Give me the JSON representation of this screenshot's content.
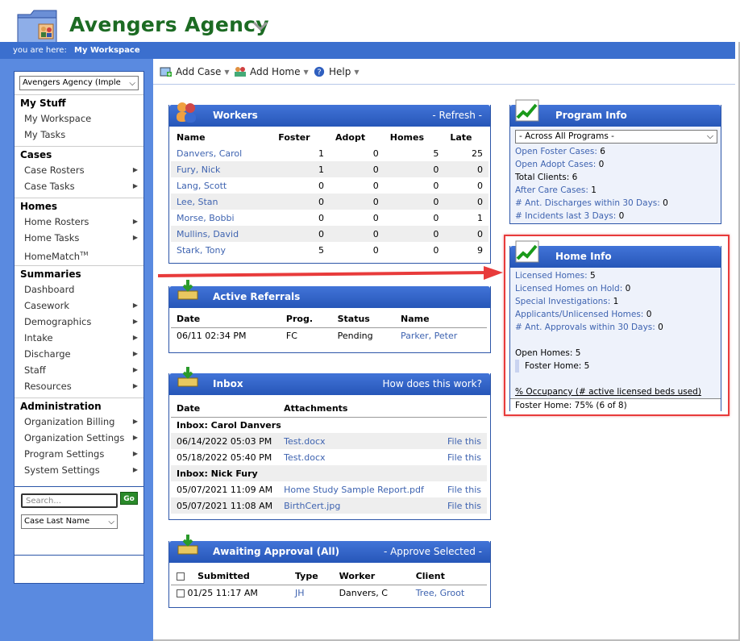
{
  "header": {
    "title": "Avengers Agency",
    "breadcrumb_label": "you are here:",
    "breadcrumb_value": "My Workspace"
  },
  "nav": {
    "agency_select": "Avengers Agency (Imple",
    "sections": [
      {
        "heading": "My Stuff",
        "items": [
          {
            "label": "My Workspace",
            "arrow": false
          },
          {
            "label": "My Tasks",
            "arrow": false
          }
        ]
      },
      {
        "heading": "Cases",
        "items": [
          {
            "label": "Case Rosters",
            "arrow": true
          },
          {
            "label": "Case Tasks",
            "arrow": true
          }
        ]
      },
      {
        "heading": "Homes",
        "items": [
          {
            "label": "Home Rosters",
            "arrow": true
          },
          {
            "label": "Home Tasks",
            "arrow": true
          },
          {
            "label": "HomeMatch",
            "sup": "TM",
            "arrow": false
          }
        ]
      },
      {
        "heading": "Summaries",
        "items": [
          {
            "label": "Dashboard",
            "arrow": false
          },
          {
            "label": "Casework",
            "arrow": true
          },
          {
            "label": "Demographics",
            "arrow": true
          },
          {
            "label": "Intake",
            "arrow": true
          },
          {
            "label": "Discharge",
            "arrow": true
          },
          {
            "label": "Staff",
            "arrow": true
          },
          {
            "label": "Resources",
            "arrow": true
          }
        ]
      },
      {
        "heading": "Administration",
        "items": [
          {
            "label": "Organization Billing",
            "arrow": true
          },
          {
            "label": "Organization Settings",
            "arrow": true
          },
          {
            "label": "Program Settings",
            "arrow": true
          },
          {
            "label": "System Settings",
            "arrow": true
          }
        ]
      }
    ],
    "search_placeholder": "Search...",
    "go_label": "Go",
    "search_type": "Case Last Name"
  },
  "toolbar": {
    "add_case": "Add Case",
    "add_home": "Add Home",
    "help": "Help"
  },
  "workers": {
    "title": "Workers",
    "refresh": "- Refresh -",
    "columns": [
      "Name",
      "Foster",
      "Adopt",
      "Homes",
      "Late"
    ],
    "rows": [
      [
        "Danvers, Carol",
        "1",
        "0",
        "5",
        "25"
      ],
      [
        "Fury, Nick",
        "1",
        "0",
        "0",
        "0"
      ],
      [
        "Lang, Scott",
        "0",
        "0",
        "0",
        "0"
      ],
      [
        "Lee, Stan",
        "0",
        "0",
        "0",
        "0"
      ],
      [
        "Morse, Bobbi",
        "0",
        "0",
        "0",
        "1"
      ],
      [
        "Mullins, David",
        "0",
        "0",
        "0",
        "0"
      ],
      [
        "Stark, Tony",
        "5",
        "0",
        "0",
        "9"
      ]
    ]
  },
  "referrals": {
    "title": "Active Referrals",
    "columns": [
      "Date",
      "Prog.",
      "Status",
      "Name"
    ],
    "rows": [
      [
        "06/11 02:34 PM",
        "FC",
        "Pending",
        "Parker, Peter"
      ]
    ]
  },
  "inbox": {
    "title": "Inbox",
    "how": "How does this work?",
    "columns": [
      "Date",
      "Attachments"
    ],
    "groups": [
      {
        "name": "Inbox: Carol Danvers",
        "rows": [
          [
            "06/14/2022 05:03 PM",
            "Test.docx",
            "File this"
          ],
          [
            "05/18/2022 05:40 PM",
            "Test.docx",
            "File this"
          ]
        ]
      },
      {
        "name": "Inbox: Nick Fury",
        "rows": [
          [
            "05/07/2021 11:09 AM",
            "Home Study Sample Report.pdf",
            "File this"
          ],
          [
            "05/07/2021 11:08 AM",
            "BirthCert.jpg",
            "File this"
          ]
        ]
      }
    ]
  },
  "approval": {
    "title": "Awaiting Approval (All)",
    "approve": "- Approve Selected -",
    "columns": [
      "Submitted",
      "Type",
      "Worker",
      "Client"
    ],
    "rows": [
      [
        "01/25 11:17 AM",
        "JH",
        "Danvers, C",
        "Tree, Groot"
      ]
    ]
  },
  "program_info": {
    "title": "Program Info",
    "select": "- Across All Programs -",
    "rows": [
      {
        "label": "Open Foster Cases:",
        "value": "6",
        "link": true
      },
      {
        "label": "Open Adopt Cases:",
        "value": "0",
        "link": true
      },
      {
        "label": "Total Clients:",
        "value": "6",
        "link": false
      },
      {
        "label": "After Care Cases:",
        "value": "1",
        "link": true
      },
      {
        "label": "# Ant. Discharges within 30 Days:",
        "value": "0",
        "link": true
      },
      {
        "label": "# Incidents last 3 Days:",
        "value": "0",
        "link": true
      }
    ]
  },
  "home_info": {
    "title": "Home Info",
    "rows": [
      {
        "label": "Licensed Homes:",
        "value": "5"
      },
      {
        "label": "Licensed Homes on Hold:",
        "value": "0"
      },
      {
        "label": "Special Investigations:",
        "value": "1"
      },
      {
        "label": "Applicants/Unlicensed Homes:",
        "value": "0"
      },
      {
        "label": "# Ant. Approvals within 30 Days:",
        "value": "0"
      }
    ],
    "open_homes": "Open Homes: 5",
    "foster_home": "Foster Home: 5",
    "occupancy_label": "% Occupancy (# active licensed beds used)",
    "occupancy_value": "Foster Home: 75% (6 of 8)"
  }
}
